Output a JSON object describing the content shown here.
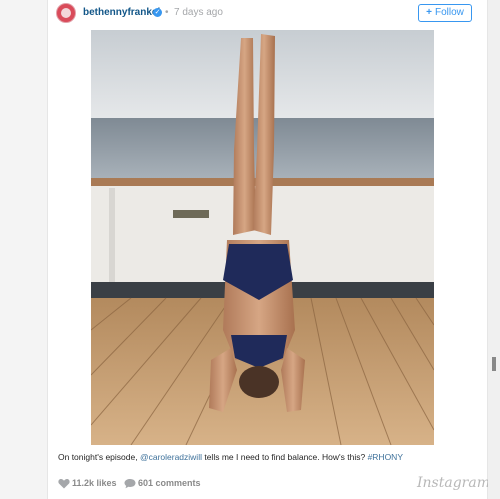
{
  "header": {
    "username": "bethennyfrankel",
    "separator": "•",
    "timestamp": "7 days ago",
    "follow_label": "Follow",
    "follow_plus": "+"
  },
  "post": {
    "caption_text_1": "On tonight's episode, ",
    "mention": "@caroleradziwill",
    "caption_text_2": " tells me I need to find balance. How's this? ",
    "hashtag": "#RHONY"
  },
  "footer": {
    "likes": "11.2k likes",
    "comments": "601 comments",
    "brand": "Instagram"
  },
  "icons": {
    "verified": "verified-badge-icon",
    "heart": "heart-icon",
    "comment": "comment-bubble-icon"
  },
  "colors": {
    "username": "#125688",
    "link": "#3f729b",
    "follow": "#3897f0",
    "muted": "#a5a7aa"
  }
}
